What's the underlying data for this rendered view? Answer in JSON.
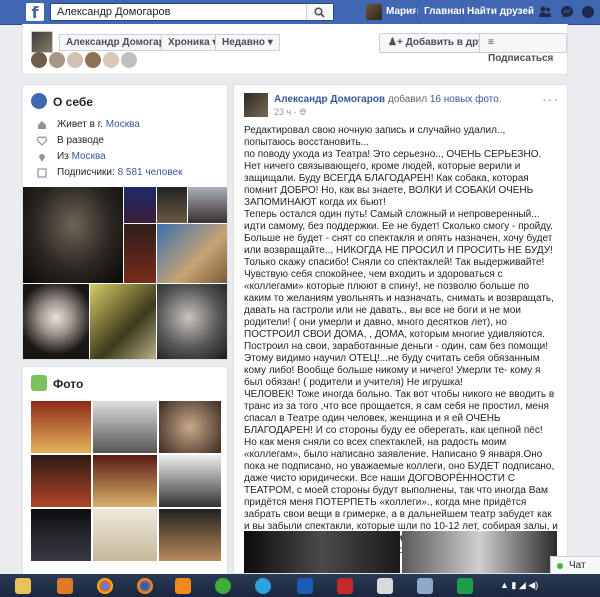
{
  "topbar": {
    "logo": "f",
    "search_value": "Александр Домогаров",
    "user_name": "Мария",
    "home_label": "Главная",
    "find_friends_label": "Найти друзей"
  },
  "profile_strip": {
    "name": "Александр Домогаров",
    "timeline_label": "Хроника",
    "recent_label": "Недавно",
    "add_friend_label": "Добавить в друзья",
    "follow_label": "Подписаться"
  },
  "about": {
    "title": "О себе",
    "lives_prefix": "Живет в г. ",
    "lives_city": "Москва",
    "relationship": "В разводе",
    "from_prefix": "Из ",
    "from_city": "Москва",
    "followers_prefix": "Подписчики: ",
    "followers_count": "8 581 человек"
  },
  "photos": {
    "title": "Фото"
  },
  "post": {
    "author": "Александр Домогаров",
    "added": " добавил ",
    "photos_count": "16 новых фото",
    "time": "23 ч · ",
    "paragraphs": [
      "Редактировал свою ночную запись и случайно удалил.., попытаюсь восстановить...",
      "по поводу ухода из Театра! Это серьезно.., ОЧЕНЬ СЕРЬЕЗНО. Нет ничего связывающего, кроме людей, которые верили и защищали. Буду ВСЕГДА БЛАГОДАРЕН! Как собака, которая помнит ДОБРО! Но, как вы знаете, ВОЛКИ И СОБАКИ ОЧЕНЬ ЗАПОМИНАЮТ когда их бьют!",
      "Теперь остался один путь! Самый сложный и непроверенный... идти самому, без поддержки. Ее не будет! Сколько смогу - пройду. Больше не будет - снят со спектакля и опять назначен, хочу будет или возвращайте.., НИКОГДА НЕ ПРОСИЛ И ПРОСИТЬ НЕ БУДУ! Только скажу спасибо! Сняли со спектаклей! Так выдерживайте! Чувствую себя спокойнее, чем входить и здороваться с «коллегами» которые плюют в спину!, не позволю больше по каким то желаниям увольнять и назначать, снимать и возвращать, давать на гастроли или не давать., вы все не боги и не мои родители! ( они умерли и давно, много десятков лет), но ПОСТРОИЛ СВОИ ДОМА, , ДОМА, которым многие удивляются. Построил на свои, заработанные деньги - один, сам без помощи! Этому видимо научил ОТЕЦ!...не буду считать себя обязанным кому либо! Вообще больше никому и ничего! Умерли те- кому я был обязан! ( родители и учителя) Не игрушка!",
      "ЧЕЛОВЕК! Тоже иногда больно. Так вот чтобы никого не вводить в транс из за того ,что все прощается, я сам себя не простил, меня спасал в Театре один человек, женщина и я ей ОЧЕНЬ БЛАГОДАРЕН! И со стороны буду ее оберегать, как цепной пёс!",
      "Но как меня сняли со всех спектаклей, на радость моим «коллегам», было написано заявление. Написано 9 января.Оно пока не подписано, но уважаемые коллеги, оно БУДЕТ подписано, даже чисто юридически. Все наши ДОГОВОРЁННОСТИ С ТЕАТРОМ, с моей стороны будут выполнены, так что иногда Вам придётся меня ПОТЕРПЕТЬ «коллеги»., когда мне придётся забрать свои вещи в гримерке, а в дальнейшем театр забудет как и вы забыли спектакли, которые шли по 10-12 лет, собирая залы, и вы забудете, как разрушали из., могу назвать фамилии и способы разрушения., не буду. Живите , Бог вам судья.Прощайте «коллеги»."
    ]
  },
  "chat": {
    "label": "Чат"
  },
  "colors": {
    "brand": "#4267b2",
    "link": "#365899",
    "bg": "#e9ebee"
  }
}
